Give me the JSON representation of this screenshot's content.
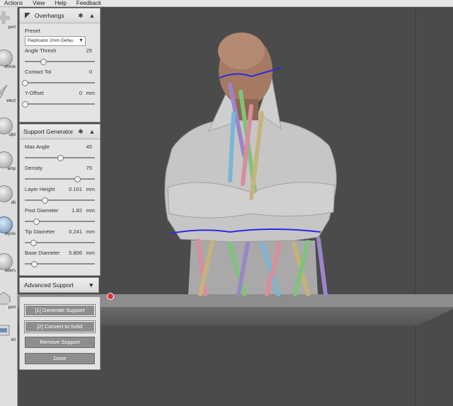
{
  "menu": [
    "Actions",
    "View",
    "Help",
    "Feedback"
  ],
  "tools": [
    {
      "icon": "plus-icon",
      "label": "port"
    },
    {
      "icon": "meshmix-icon",
      "label": "shmix"
    },
    {
      "icon": "select-icon",
      "label": "elect"
    },
    {
      "icon": "sculpt-icon",
      "label": "ulpt"
    },
    {
      "icon": "stamp-icon",
      "label": "amp"
    },
    {
      "icon": "edit-icon",
      "label": "dit"
    },
    {
      "icon": "analysis-icon",
      "label": "alysis"
    },
    {
      "icon": "shaders-icon",
      "label": "aders"
    },
    {
      "icon": "export-icon",
      "label": "port"
    },
    {
      "icon": "print-icon",
      "label": "int"
    }
  ],
  "overhangs": {
    "title": "Overhangs",
    "preset_label": "Preset",
    "preset_value": "Replicator 2mm Defau",
    "params": [
      {
        "label": "Angle Thresh",
        "value": "25",
        "unit": "",
        "fraction": 0.26
      },
      {
        "label": "Contact Tol",
        "value": "0",
        "unit": "",
        "fraction": 0.0
      },
      {
        "label": "Y-Offset",
        "value": "0",
        "unit": "mm",
        "fraction": 0.0
      }
    ]
  },
  "support_generator": {
    "title": "Support Generator",
    "params": [
      {
        "label": "Max Angle",
        "value": "45",
        "unit": "",
        "fraction": 0.5
      },
      {
        "label": "Density",
        "value": "75",
        "unit": "",
        "fraction": 0.75
      },
      {
        "label": "Layer Height",
        "value": "0.101",
        "unit": "mm",
        "fraction": 0.28
      },
      {
        "label": "Post Diameter",
        "value": "1.82",
        "unit": "mm",
        "fraction": 0.16
      },
      {
        "label": "Tip Diameter",
        "value": "0.241",
        "unit": "mm",
        "fraction": 0.12
      },
      {
        "label": "Base Diameter",
        "value": "5.806",
        "unit": "mm",
        "fraction": 0.13
      }
    ]
  },
  "advanced_support": {
    "title": "Advanced Support"
  },
  "buttons": {
    "generate": "[1] Generate Support",
    "convert": "[2] Convert to Solid",
    "remove": "Remove Support",
    "done": "Done"
  },
  "colors": {
    "accent": "#8e8e8e",
    "origin": "#dd3333"
  }
}
